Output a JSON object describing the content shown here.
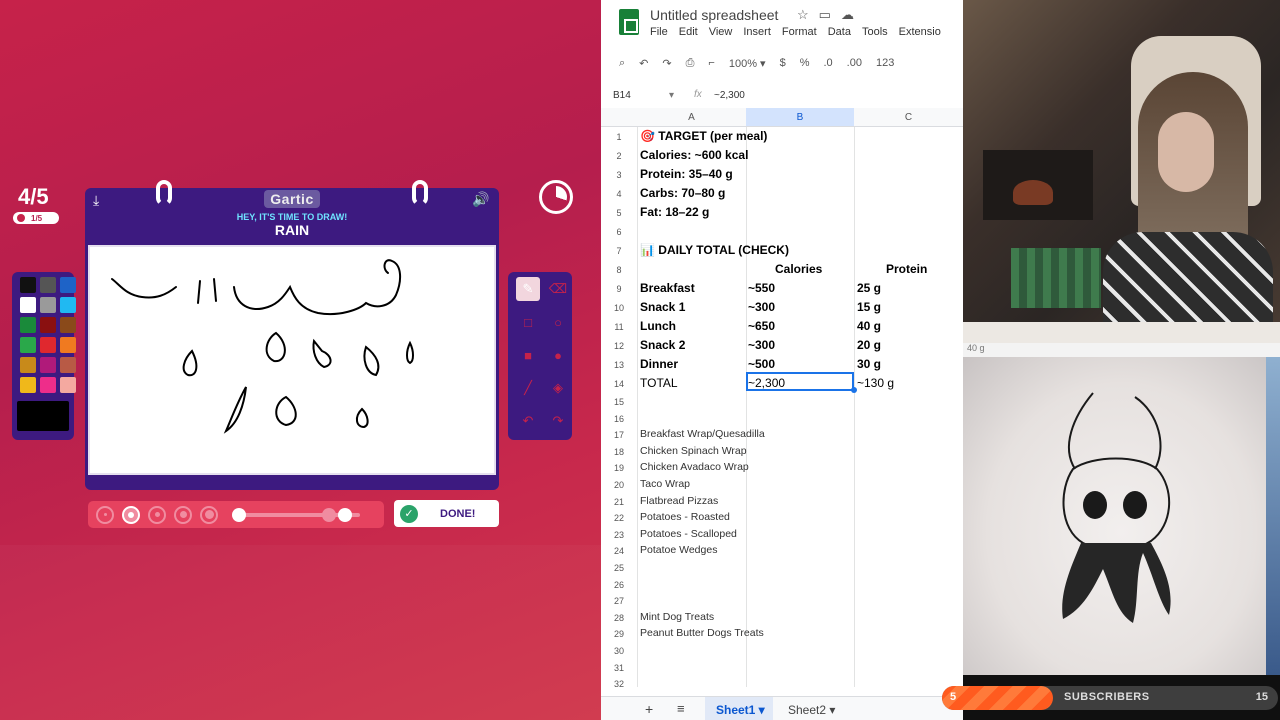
{
  "gartic": {
    "round": "4/5",
    "round_sub": "1/5",
    "logo": "Gartic",
    "prompt_line": "HEY, IT'S TIME TO DRAW!",
    "word": "RAIN",
    "done_label": "DONE!",
    "timer_fraction_elapsed": 0.3,
    "palette": [
      "#111111",
      "#555555",
      "#1e63c7",
      "#ffffff",
      "#9a9a9a",
      "#20b9f2",
      "#1a8a3a",
      "#8a1010",
      "#8a4a1a",
      "#2aa84a",
      "#e0282e",
      "#f07a20",
      "#c88a1a",
      "#b01a7a",
      "#b85a45",
      "#f0b81a",
      "#ee2d8a",
      "#f4a9a0"
    ],
    "current_color": "#000000",
    "tools": [
      "pen-icon",
      "eraser-icon",
      "rectangle-outline-icon",
      "circle-outline-icon",
      "rectangle-fill-icon",
      "circle-fill-icon",
      "line-icon",
      "fill-bucket-icon",
      "undo-icon",
      "redo-icon"
    ],
    "brush_sizes": 5,
    "brush_size_selected": 1
  },
  "sheets": {
    "title": "Untitled spreadsheet",
    "menu": [
      "File",
      "Edit",
      "View",
      "Insert",
      "Format",
      "Data",
      "Tools",
      "Extensio"
    ],
    "toolbar": {
      "zoom": "100%",
      "currency": "$",
      "percent": "%",
      "dec_less": ".0",
      "dec_more": ".00",
      "number_format": "123"
    },
    "name_box": "B14",
    "fx": "fx",
    "formula_value": "~2,300",
    "columns": [
      "A",
      "B",
      "C"
    ],
    "rows": [
      {
        "n": "1",
        "a": "🎯 TARGET (per meal)",
        "b": "",
        "c": "",
        "bold": true
      },
      {
        "n": "2",
        "a": "Calories: ~600 kcal",
        "b": "",
        "c": "",
        "bold": true
      },
      {
        "n": "3",
        "a": "Protein: 35–40 g",
        "b": "",
        "c": "",
        "bold": true
      },
      {
        "n": "4",
        "a": "Carbs: 70–80 g",
        "b": "",
        "c": "",
        "bold": true
      },
      {
        "n": "5",
        "a": "Fat: 18–22 g",
        "b": "",
        "c": "",
        "bold": true
      },
      {
        "n": "6",
        "a": "",
        "b": "",
        "c": "",
        "bold": true
      },
      {
        "n": "7",
        "a": "📊 DAILY TOTAL (CHECK)",
        "b": "",
        "c": "",
        "bold": true
      },
      {
        "n": "8",
        "a": "",
        "b": "Calories",
        "c": "Protein",
        "bold": true
      },
      {
        "n": "9",
        "a": "Breakfast",
        "b": "~550",
        "c": "25 g",
        "bold": true
      },
      {
        "n": "10",
        "a": "Snack 1",
        "b": "~300",
        "c": "15 g",
        "bold": true
      },
      {
        "n": "11",
        "a": "Lunch",
        "b": "~650",
        "c": "40 g",
        "bold": true
      },
      {
        "n": "12",
        "a": "Snack 2",
        "b": "~300",
        "c": "20 g",
        "bold": true
      },
      {
        "n": "13",
        "a": "Dinner",
        "b": "~500",
        "c": "30 g",
        "bold": true
      },
      {
        "n": "14",
        "a": "TOTAL",
        "b": "~2,300",
        "c": "~130 g",
        "bold": false
      }
    ],
    "small_rows": [
      {
        "n": "15",
        "a": ""
      },
      {
        "n": "16",
        "a": ""
      },
      {
        "n": "17",
        "a": "Breakfast Wrap/Quesadilla"
      },
      {
        "n": "18",
        "a": "Chicken Spinach Wrap"
      },
      {
        "n": "19",
        "a": "Chicken Avadaco Wrap"
      },
      {
        "n": "20",
        "a": "Taco Wrap"
      },
      {
        "n": "21",
        "a": "Flatbread Pizzas"
      },
      {
        "n": "22",
        "a": "Potatoes - Roasted"
      },
      {
        "n": "23",
        "a": "Potatoes - Scalloped"
      },
      {
        "n": "24",
        "a": "Potatoe Wedges"
      },
      {
        "n": "25",
        "a": ""
      },
      {
        "n": "26",
        "a": ""
      },
      {
        "n": "27",
        "a": ""
      },
      {
        "n": "28",
        "a": "Mint Dog Treats"
      },
      {
        "n": "29",
        "a": "Peanut Butter Dogs Treats"
      },
      {
        "n": "30",
        "a": ""
      },
      {
        "n": "31",
        "a": ""
      },
      {
        "n": "32",
        "a": ""
      }
    ],
    "sheet_tabs": [
      "Sheet1 ▾",
      "Sheet2 ▾"
    ]
  },
  "webcam": {
    "partial_text": "40 g"
  },
  "subs": {
    "count": "5",
    "label": "SUBSCRIBERS",
    "goal": "15",
    "progress_fraction": 0.33
  }
}
